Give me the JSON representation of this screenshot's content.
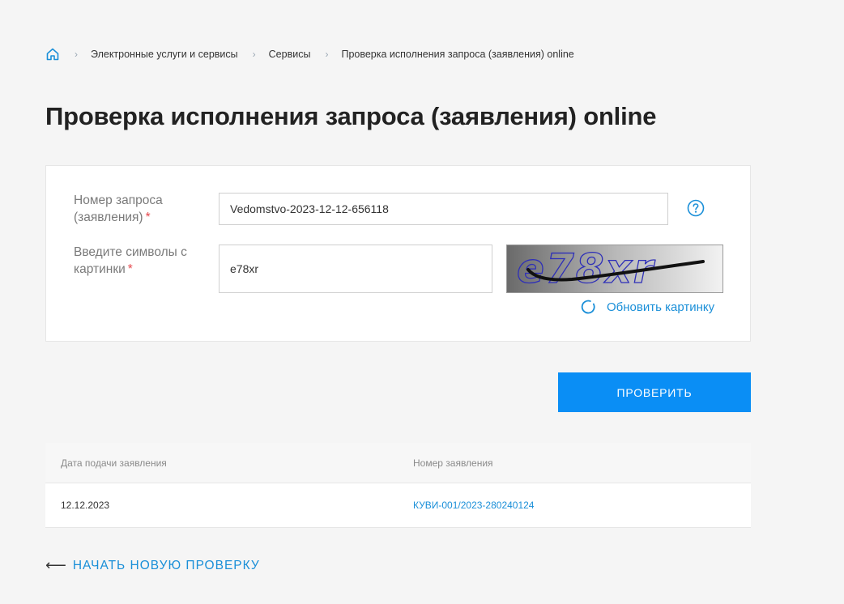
{
  "breadcrumb": {
    "items": [
      {
        "label": "Электронные услуги и сервисы"
      },
      {
        "label": "Сервисы"
      },
      {
        "label": "Проверка исполнения запроса (заявления) online"
      }
    ],
    "separator": "›"
  },
  "page": {
    "title": "Проверка исполнения запроса (заявления) online"
  },
  "form": {
    "request_number_label_line1": "Номер запроса",
    "request_number_label_line2": "(заявления)",
    "required_mark": "*",
    "request_number_value": "Vedomstvo-2023-12-12-656118",
    "captcha_label_line1": "Введите символы с",
    "captcha_label_line2": "картинки",
    "captcha_value": "e78xr",
    "captcha_image_text": "e78xr",
    "refresh_label": "Обновить картинку"
  },
  "actions": {
    "check_label": "ПРОВЕРИТЬ",
    "new_check_arrow": "⟵",
    "new_check_label": "НАЧАТЬ НОВУЮ ПРОВЕРКУ"
  },
  "results": {
    "columns": [
      "Дата подачи заявления",
      "Номер заявления"
    ],
    "rows": [
      {
        "date": "12.12.2023",
        "number": "КУВИ-001/2023-280240124"
      }
    ]
  },
  "colors": {
    "accent": "#0a8ef5",
    "link": "#1a8fd8",
    "required": "#e5484d"
  }
}
